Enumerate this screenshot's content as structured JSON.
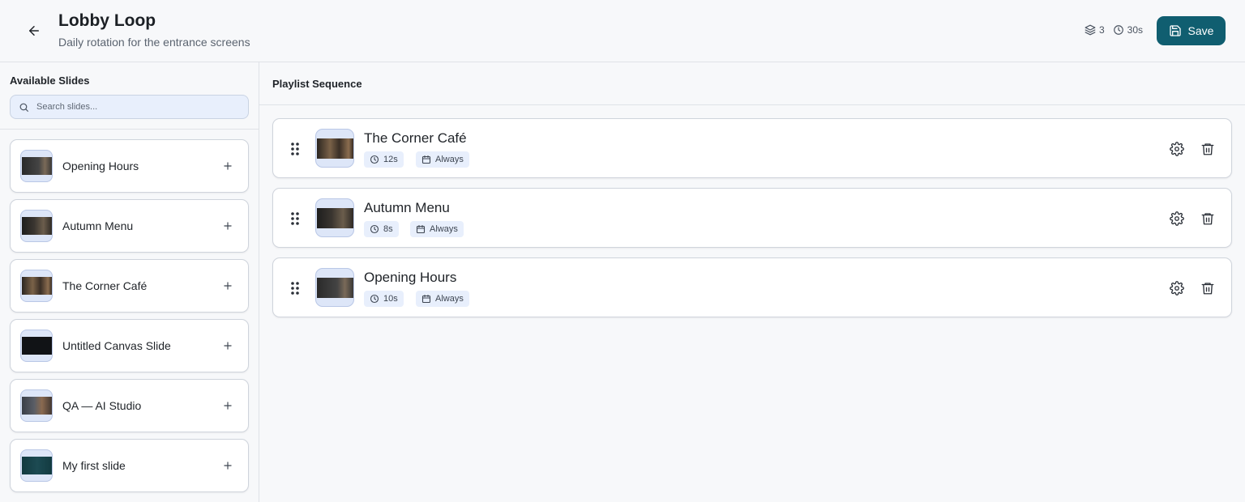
{
  "header": {
    "title": "Lobby Loop",
    "subtitle": "Daily rotation for the entrance screens",
    "slide_count": "3",
    "total_duration": "30s",
    "save_label": "Save",
    "back_icon": "arrow-left-icon"
  },
  "sidebar": {
    "title": "Available Slides",
    "search_placeholder": "Search slides...",
    "slides": [
      {
        "name": "Opening Hours"
      },
      {
        "name": "Autumn Menu"
      },
      {
        "name": "The Corner Café"
      },
      {
        "name": "Untitled Canvas Slide"
      },
      {
        "name": "QA — AI Studio"
      },
      {
        "name": "My first slide"
      }
    ]
  },
  "playlist": {
    "title": "Playlist Sequence",
    "items": [
      {
        "name": "The Corner Café",
        "duration": "12s",
        "schedule": "Always"
      },
      {
        "name": "Autumn Menu",
        "duration": "8s",
        "schedule": "Always"
      },
      {
        "name": "Opening Hours",
        "duration": "10s",
        "schedule": "Always"
      }
    ]
  },
  "colors": {
    "accent": "#105e70",
    "chip_bg": "#e8effc",
    "search_bg": "#e8effc",
    "page_bg": "#f7f8fa"
  }
}
